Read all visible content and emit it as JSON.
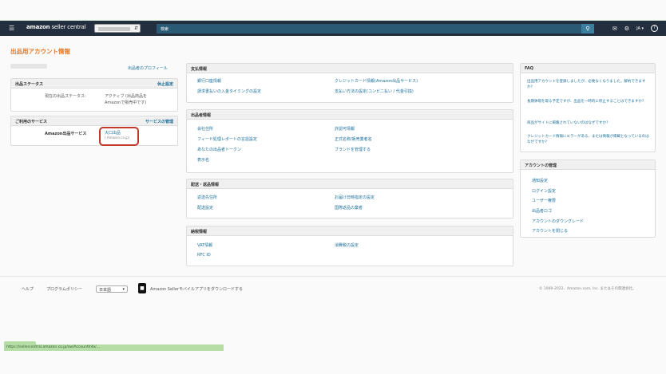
{
  "topbar": {
    "menu_icon": "hamburger-icon",
    "logo_brand": "amazon",
    "logo_suffix": "seller central",
    "search_placeholder": "検索",
    "language": "JA"
  },
  "page": {
    "title": "出品用アカウント情報"
  },
  "left": {
    "profile_link": "出品者のプロフィール",
    "status": {
      "heading": "出品ステータス",
      "action": "休止設定",
      "label": "現在の出品ステータス:",
      "value_line1": "アクティブ (出品商品を",
      "value_line2": "Amazonで販売中です)"
    },
    "services": {
      "heading": "ご利用のサービス",
      "action": "サービスの管理",
      "label": "Amazon出品サービス",
      "value_line1": "大口出品",
      "value_line2": "(.Amazon.co.jp)"
    }
  },
  "payment": {
    "heading": "支払情報",
    "items": [
      "銀行口座情報",
      "クレジットカード情報(Amazon出品サービス)",
      "請求書払いの入金タイミングの設定",
      "支払い方法の設定(コンビニ払い / 代金引換)"
    ]
  },
  "seller": {
    "heading": "出品者情報",
    "items": [
      "会社住所",
      "許認可情報",
      "フィード処理レポートの言語設定",
      "正式名称/販売業者名",
      "あなたの出品者トークン",
      "ブランドを管理する",
      "表示名"
    ]
  },
  "shipping": {
    "heading": "配送・返品情報",
    "items": [
      "返送先住所",
      "お届け日時指定の設定",
      "配送設定",
      "国際返品の業者"
    ]
  },
  "tax": {
    "heading": "納税情報",
    "items": [
      "VAT情報",
      "消費税の設定",
      "RFC ID"
    ]
  },
  "faq": {
    "heading": "FAQ",
    "items": [
      "出品用アカウントを登録しましたが、必要なくなりました。解約できますか?",
      "長期休暇を取る予定ですが、出品を一時的に停止することはできますか?",
      "商品がサイトに掲載されていないのはなぜですか?",
      "クレジットカード情報にエラーがある、または情報が掲載となっているのはなぜですか?"
    ]
  },
  "account": {
    "heading": "アカウントの管理",
    "items": [
      "通知設定",
      "ログイン設定",
      "ユーザー権限",
      "出品者ロゴ",
      "アカウントのダウングレード",
      "アカウントを閉じる"
    ]
  },
  "footer": {
    "help": "ヘルプ",
    "policy": "プログラムポリシー",
    "language_select": "日本語",
    "app_download": "Amazon Sellerモバイルアプリをダウンロードする",
    "copyright": "© 1999-2022、Amazon.com, Inc. またはその関連会社。"
  },
  "statusbar": {
    "url": "https://sellercentral.amazon.co.jp/sw/AccountInfo/..."
  }
}
